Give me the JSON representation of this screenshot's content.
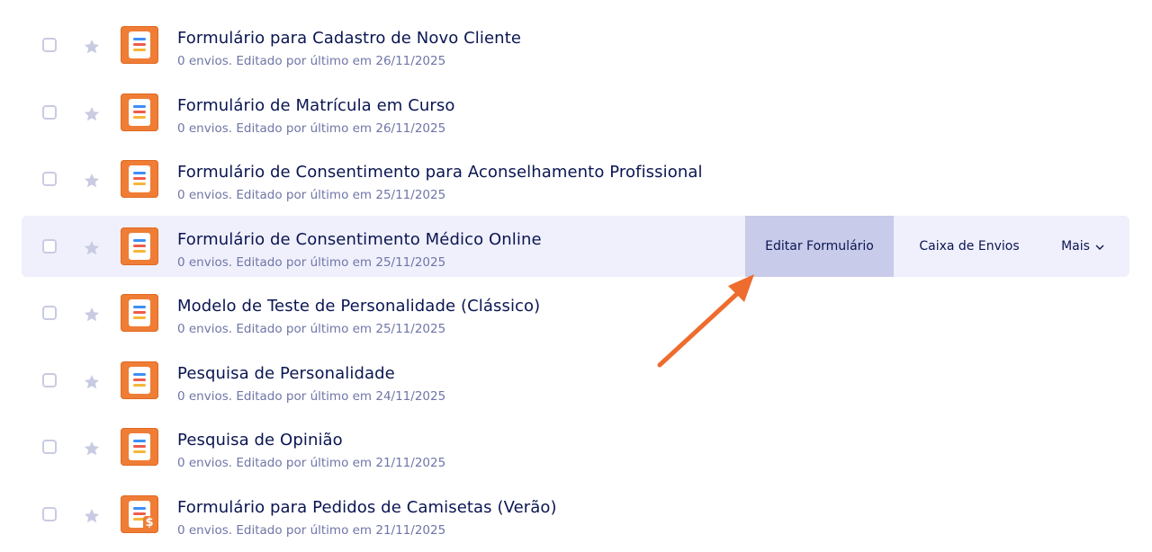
{
  "forms": [
    {
      "title": "Formulário para Cadastro de Novo Cliente",
      "subtitle": "0 envios. Editado por último em 26/11/2025",
      "icon": "form-icon"
    },
    {
      "title": "Formulário de Matrícula em Curso",
      "subtitle": "0 envios. Editado por último em 26/11/2025",
      "icon": "form-icon"
    },
    {
      "title": "Formulário de Consentimento para Aconselhamento Profissional",
      "subtitle": "0 envios. Editado por último em 25/11/2025",
      "icon": "form-icon"
    },
    {
      "title": "Formulário de Consentimento Médico Online",
      "subtitle": "0 envios. Editado por último em 25/11/2025",
      "icon": "form-icon"
    },
    {
      "title": "Modelo de Teste de Personalidade (Clássico)",
      "subtitle": "0 envios. Editado por último em 25/11/2025",
      "icon": "form-icon"
    },
    {
      "title": "Pesquisa de Personalidade",
      "subtitle": "0 envios. Editado por último em 24/11/2025",
      "icon": "form-icon"
    },
    {
      "title": "Pesquisa de Opinião",
      "subtitle": "0 envios. Editado por último em 21/11/2025",
      "icon": "form-icon"
    },
    {
      "title": "Formulário para Pedidos de Camisetas (Verão)",
      "subtitle": "0 envios. Editado por último em 21/11/2025",
      "icon": "payment-form-icon"
    }
  ],
  "hovered_row": 3,
  "actions": {
    "edit_label": "Editar Formulário",
    "inbox_label": "Caixa de Envios",
    "more_label": "Mais"
  },
  "colors": {
    "title": "#0a1551",
    "subtitle": "#6f76a7",
    "hover_row": "#f0f0fc",
    "edit_button": "#c8cbe9",
    "form_icon": "#f07d35",
    "annotation_arrow": "#ee6c2e"
  }
}
